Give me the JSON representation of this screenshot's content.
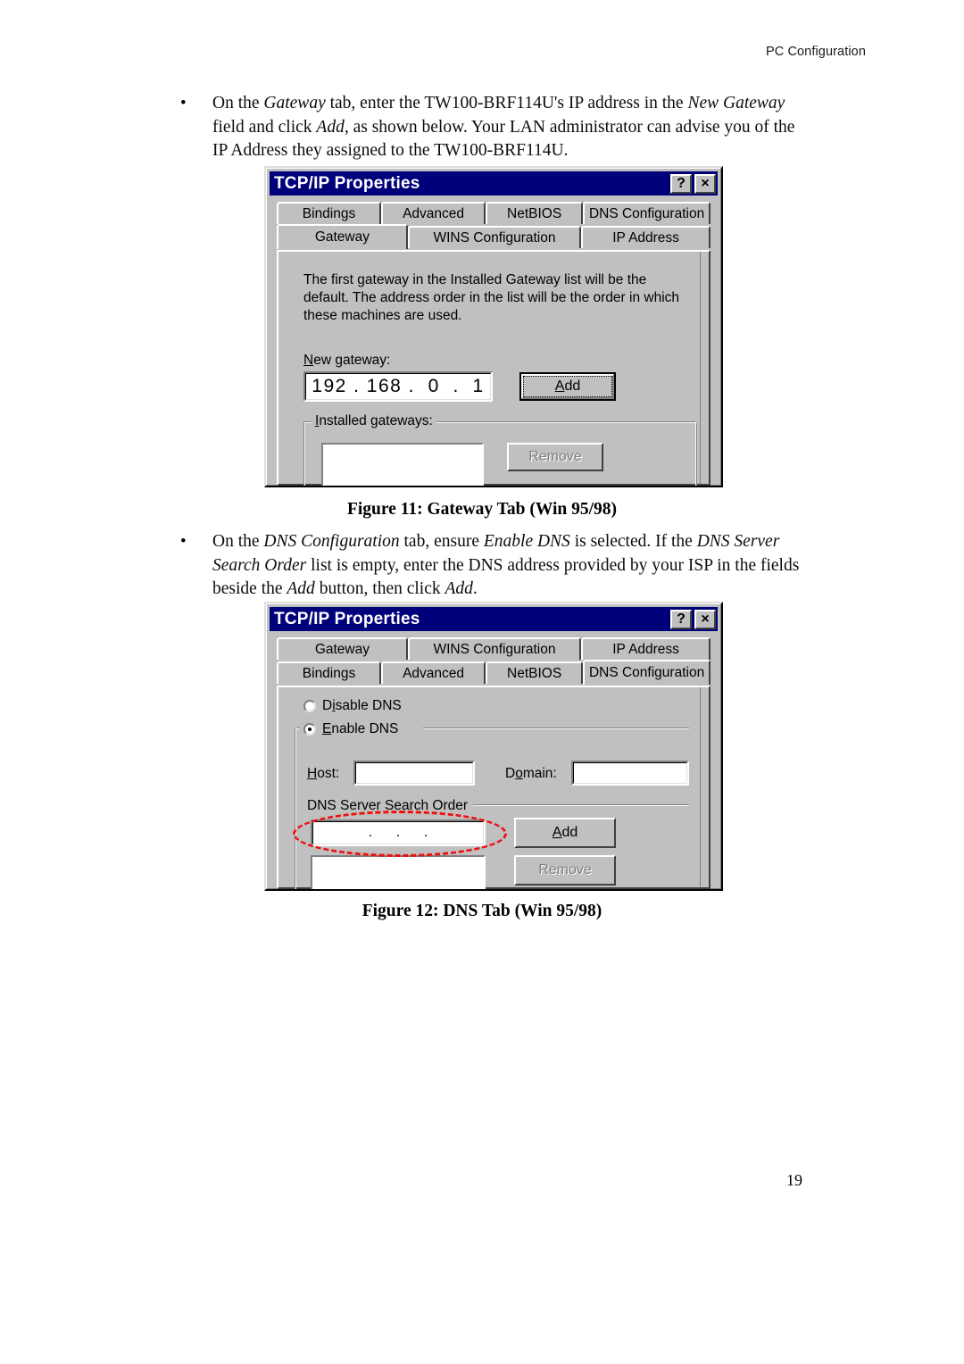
{
  "header": {
    "running_title": "PC Configuration",
    "page_number": "19"
  },
  "bullets": [
    {
      "marker": "•",
      "segments": [
        {
          "text": "On the ",
          "italic": false
        },
        {
          "text": "Gateway",
          "italic": true
        },
        {
          "text": " tab, enter the TW100-BRF114U's IP address in the ",
          "italic": false
        },
        {
          "text": "New Gateway",
          "italic": true
        },
        {
          "text": " field and click ",
          "italic": false
        },
        {
          "text": "Add",
          "italic": true
        },
        {
          "text": ", as shown below. Your LAN administrator can advise you of the IP Address they assigned to the TW100-BRF114U.",
          "italic": false
        }
      ]
    },
    {
      "marker": "•",
      "segments": [
        {
          "text": "On the ",
          "italic": false
        },
        {
          "text": "DNS Configuration",
          "italic": true
        },
        {
          "text": " tab, ensure ",
          "italic": false
        },
        {
          "text": "Enable DNS",
          "italic": true
        },
        {
          "text": " is selected. If the ",
          "italic": false
        },
        {
          "text": "DNS Server Search Order",
          "italic": true
        },
        {
          "text": " list is empty, enter the DNS address provided by your ISP in the fields beside the ",
          "italic": false
        },
        {
          "text": "Add",
          "italic": true
        },
        {
          "text": " button, then click ",
          "italic": false
        },
        {
          "text": "Add",
          "italic": true
        },
        {
          "text": ".",
          "italic": false
        }
      ]
    }
  ],
  "figures": [
    {
      "caption": "Figure 11: Gateway Tab (Win 95/98)"
    },
    {
      "caption": "Figure 12: DNS Tab (Win 95/98)"
    }
  ],
  "dialog_gateway": {
    "title": "TCP/IP Properties",
    "help_button": "?",
    "close_button": "×",
    "tab_row_top": [
      {
        "label": "Bindings",
        "active": false
      },
      {
        "label": "Advanced",
        "active": false
      },
      {
        "label": "NetBIOS",
        "active": false
      },
      {
        "label": "DNS Configuration",
        "active": false
      }
    ],
    "tab_row_bottom": [
      {
        "label": "Gateway",
        "active": true
      },
      {
        "label": "WINS Configuration",
        "active": false
      },
      {
        "label": "IP Address",
        "active": false
      }
    ],
    "description": "The first gateway in the Installed Gateway list will be the default. The address order in the list will be the order in which these machines are used.",
    "new_gateway_label": "New gateway:",
    "new_gateway_value": "192 . 168 .  0  .  1",
    "add_button": "Add",
    "installed_gateways_label": "Installed gateways:",
    "installed_gateways_items": [],
    "remove_button": "Remove",
    "remove_button_disabled": true
  },
  "dialog_dns": {
    "title": "TCP/IP Properties",
    "help_button": "?",
    "close_button": "×",
    "tab_row_top": [
      {
        "label": "Gateway",
        "active": false
      },
      {
        "label": "WINS Configuration",
        "active": false
      },
      {
        "label": "IP Address",
        "active": false
      }
    ],
    "tab_row_bottom": [
      {
        "label": "Bindings",
        "active": false
      },
      {
        "label": "Advanced",
        "active": false
      },
      {
        "label": "NetBIOS",
        "active": false
      },
      {
        "label": "DNS Configuration",
        "active": true
      }
    ],
    "radio_disable_dns": "Disable DNS",
    "radio_enable_dns": "Enable DNS",
    "selected_radio": "Enable DNS",
    "host_label": "Host:",
    "host_value": "",
    "domain_label": "Domain:",
    "domain_value": "",
    "search_order_label": "DNS Server Search Order",
    "search_order_value": ".      .      .",
    "add_button": "Add",
    "search_order_items": [],
    "remove_button": "Remove",
    "remove_button_disabled": true,
    "annotation": {
      "shape": "ellipse",
      "color": "#ee1111",
      "target": "dns-search-order-ip-field"
    }
  }
}
